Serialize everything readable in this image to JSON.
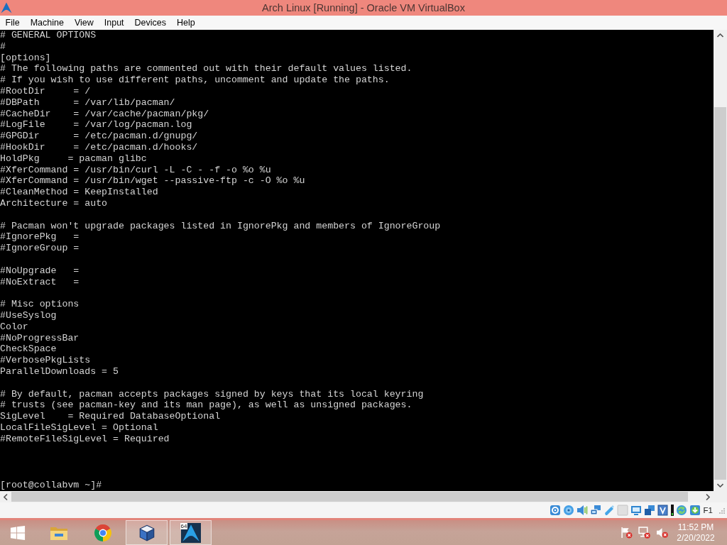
{
  "window": {
    "title": "Arch Linux [Running] - Oracle VM VirtualBox"
  },
  "menu_bar": [
    "File",
    "Machine",
    "View",
    "Input",
    "Devices",
    "Help"
  ],
  "terminal": {
    "blocks": [
      [
        "# GENERAL OPTIONS",
        "#",
        "[options]",
        "# The following paths are commented out with their default values listed.",
        "# If you wish to use different paths, uncomment and update the paths.",
        "#RootDir     = /",
        "#DBPath      = /var/lib/pacman/",
        "#CacheDir    = /var/cache/pacman/pkg/",
        "#LogFile     = /var/log/pacman.log",
        "#GPGDir      = /etc/pacman.d/gnupg/",
        "#HookDir     = /etc/pacman.d/hooks/",
        "HoldPkg     = pacman glibc",
        "#XferCommand = /usr/bin/curl -L -C - -f -o %o %u",
        "#XferCommand = /usr/bin/wget --passive-ftp -c -O %o %u",
        "#CleanMethod = KeepInstalled",
        "Architecture = auto"
      ],
      [
        "# Pacman won't upgrade packages listed in IgnorePkg and members of IgnoreGroup",
        "#IgnorePkg   =",
        "#IgnoreGroup ="
      ],
      [
        "#NoUpgrade   =",
        "#NoExtract   ="
      ],
      [
        "# Misc options",
        "#UseSyslog",
        "Color",
        "#NoProgressBar",
        "CheckSpace",
        "#VerbosePkgLists",
        "ParallelDownloads = 5"
      ],
      [
        "# By default, pacman accepts packages signed by keys that its local keyring",
        "# trusts (see pacman-key and its man page), as well as unsigned packages.",
        "SigLevel    = Required DatabaseOptional",
        "LocalFileSigLevel = Optional",
        "#RemoteFileSigLevel = Required"
      ]
    ],
    "prompt": "[root@collabvm ~]#"
  },
  "status_bar": {
    "host_key": "F1"
  },
  "taskbar": {
    "apps": [
      {
        "running": false
      },
      {
        "running": false
      },
      {
        "running": true
      },
      {
        "running": true,
        "badge": "64"
      }
    ],
    "clock": {
      "time": "11:52 PM",
      "date": "2/20/2022"
    }
  }
}
